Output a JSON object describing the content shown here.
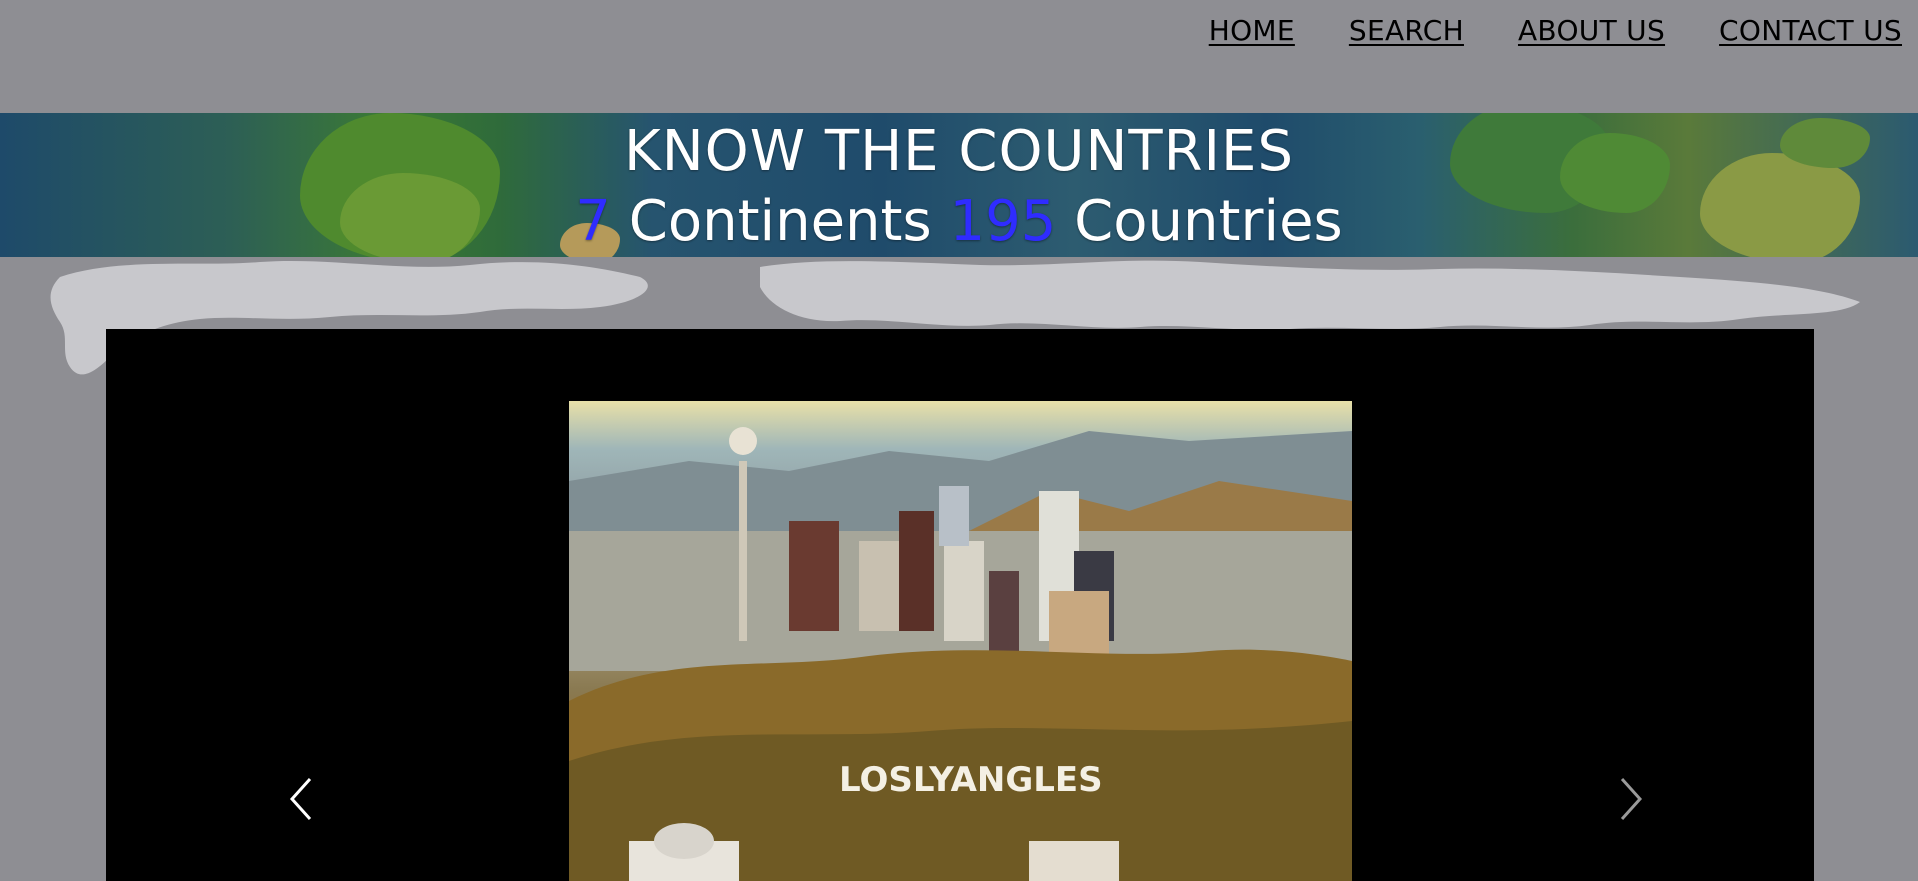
{
  "nav": {
    "items": [
      {
        "label": "HOME"
      },
      {
        "label": "SEARCH"
      },
      {
        "label": "ABOUT US"
      },
      {
        "label": "CONTACT US"
      }
    ]
  },
  "banner": {
    "title": "KNOW THE COUNTRIES",
    "continents_count": "7",
    "continents_label": " Continents ",
    "countries_count": "195",
    "countries_label": " Countries"
  },
  "carousel": {
    "slide_sign_text": "LOSLYANGLES",
    "prev_icon": "chevron-left-icon",
    "next_icon": "chevron-right-icon"
  },
  "colors": {
    "accent": "#2f2cff",
    "page_background": "#8e8e93",
    "carousel_background": "#000000"
  }
}
